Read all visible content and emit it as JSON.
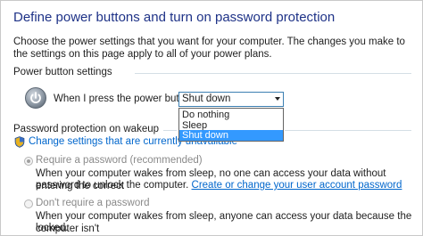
{
  "title": "Define power buttons and turn on password protection",
  "intro": "Choose the power settings that you want for your computer. The changes you make to the settings on this page apply to all of your power plans.",
  "power_section": {
    "label": "Power button settings",
    "power_button_label": "When I press the power button:",
    "selected": "Shut down",
    "options": [
      "Do nothing",
      "Sleep",
      "Shut down"
    ]
  },
  "password_section": {
    "label": "Password protection on wakeup",
    "change_link": "Change settings that are currently unavailable",
    "require_label": "Require a password (recommended)",
    "require_desc_1": "When your computer wakes from sleep, no one can access your data without entering the correct",
    "require_desc_2": "password to unlock the computer.",
    "require_link": "Create or change your user account password",
    "dont_label": "Don't require a password",
    "dont_desc_1": "When your computer wakes from sleep, anyone can access your data because the computer isn't",
    "dont_desc_2": "locked."
  },
  "colors": {
    "title": "#1e3287",
    "link": "#0066cc",
    "selected_option": "#3399ff"
  },
  "icons": [
    "power-icon",
    "shield-icon",
    "chevron-down-icon"
  ]
}
